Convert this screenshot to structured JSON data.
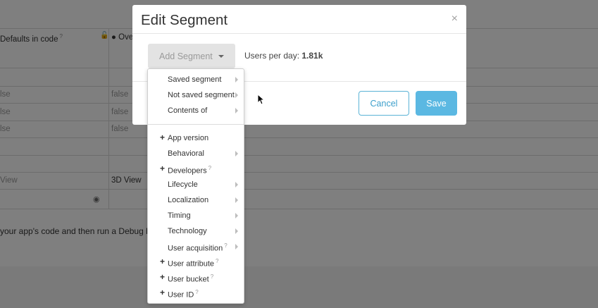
{
  "background": {
    "header_col1": "Defaults in code",
    "header_col1_q": "?",
    "header_col2": "Ove",
    "rows": [
      {
        "c1": "lse",
        "c2": "false"
      },
      {
        "c1": "lse",
        "c2": "false"
      },
      {
        "c1": "lse",
        "c2": "false"
      }
    ],
    "view_row": {
      "c1": "View",
      "c2": "3D View"
    },
    "footer_text": "your app's code and then run a Debug b"
  },
  "modal": {
    "title": "Edit Segment",
    "close": "×",
    "add_segment_label": "Add Segment",
    "users_per_day_label": "Users per day:",
    "users_per_day_value": "1.81k",
    "cancel_label": "Cancel",
    "save_label": "Save"
  },
  "dropdown": {
    "group1": [
      {
        "label": "Saved segment"
      },
      {
        "label": "Not saved segment"
      },
      {
        "label": "Contents of"
      }
    ],
    "group2": [
      {
        "label": "App version"
      },
      {
        "label": "Behavioral"
      },
      {
        "label": "Developers",
        "q": "?"
      },
      {
        "label": "Lifecycle"
      },
      {
        "label": "Localization"
      },
      {
        "label": "Timing"
      },
      {
        "label": "Technology"
      },
      {
        "label": "User acquisition",
        "q": "?"
      },
      {
        "label": "User attribute",
        "q": "?"
      },
      {
        "label": "User bucket",
        "q": "?"
      },
      {
        "label": "User ID",
        "q": "?"
      }
    ],
    "plus_symbol": "+",
    "question_symbol": "?"
  }
}
